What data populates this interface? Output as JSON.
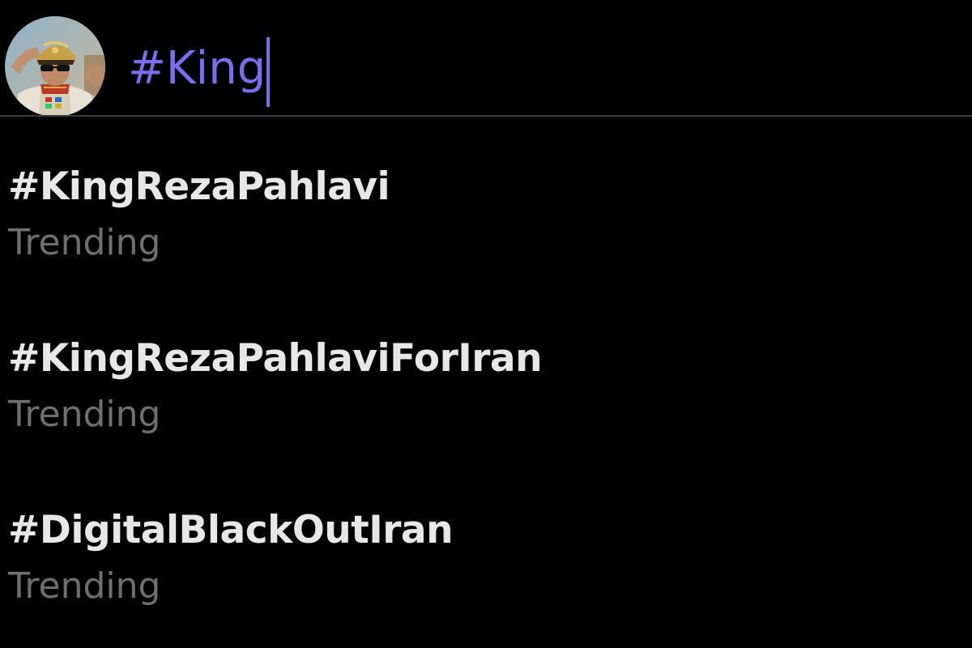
{
  "colors": {
    "background": "#000000",
    "accent": "#7b6cf0",
    "title_text": "#e7e7e7",
    "subtitle_text": "#6f6f6f"
  },
  "search": {
    "value": "#King"
  },
  "results": [
    {
      "title": "#KingRezaPahlavi",
      "subtitle": "Trending"
    },
    {
      "title": "#KingRezaPahlaviForIran",
      "subtitle": "Trending"
    },
    {
      "title": "#DigitalBlackOutIran",
      "subtitle": "Trending"
    }
  ]
}
